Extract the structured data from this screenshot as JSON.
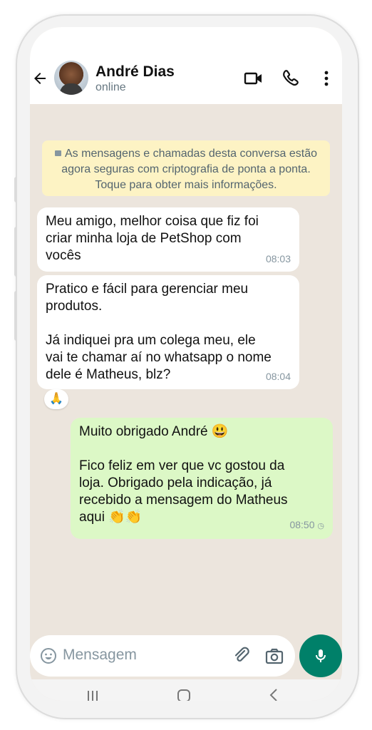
{
  "header": {
    "contact_name": "André Dias",
    "status": "online",
    "icons": [
      "back-arrow-icon",
      "video-call-icon",
      "phone-icon",
      "more-vertical-icon"
    ]
  },
  "system_message": {
    "text": "As mensagens e chamadas desta conversa estão agora seguras com criptografia de ponta a ponta. Toque para obter mais informações."
  },
  "messages": [
    {
      "direction": "incoming",
      "text": "Meu amigo, melhor coisa que fiz foi\ncriar minha loja de PetShop com\nvocês",
      "time": "08:03"
    },
    {
      "direction": "incoming",
      "text": "Pratico e fácil para gerenciar meu\nprodutos.\n\nJá indiquei pra um colega meu, ele\nvai te chamar aí no whatsapp o nome\ndele é Matheus, blz?",
      "time": "08:04",
      "reaction": "🙏"
    },
    {
      "direction": "outgoing",
      "text": "Muito obrigado André 😃\n\nFico feliz em ver que vc gostou da\nloja. Obrigado pela indicação, já\nrecebido a mensagem do Matheus\naqui 👏👏",
      "time": "08:50"
    }
  ],
  "input": {
    "placeholder": "Mensagem"
  },
  "colors": {
    "outgoing_bubble": "#dcf8c6",
    "incoming_bubble": "#ffffff",
    "accent": "#008069",
    "system_bubble": "#fdf3c4"
  }
}
